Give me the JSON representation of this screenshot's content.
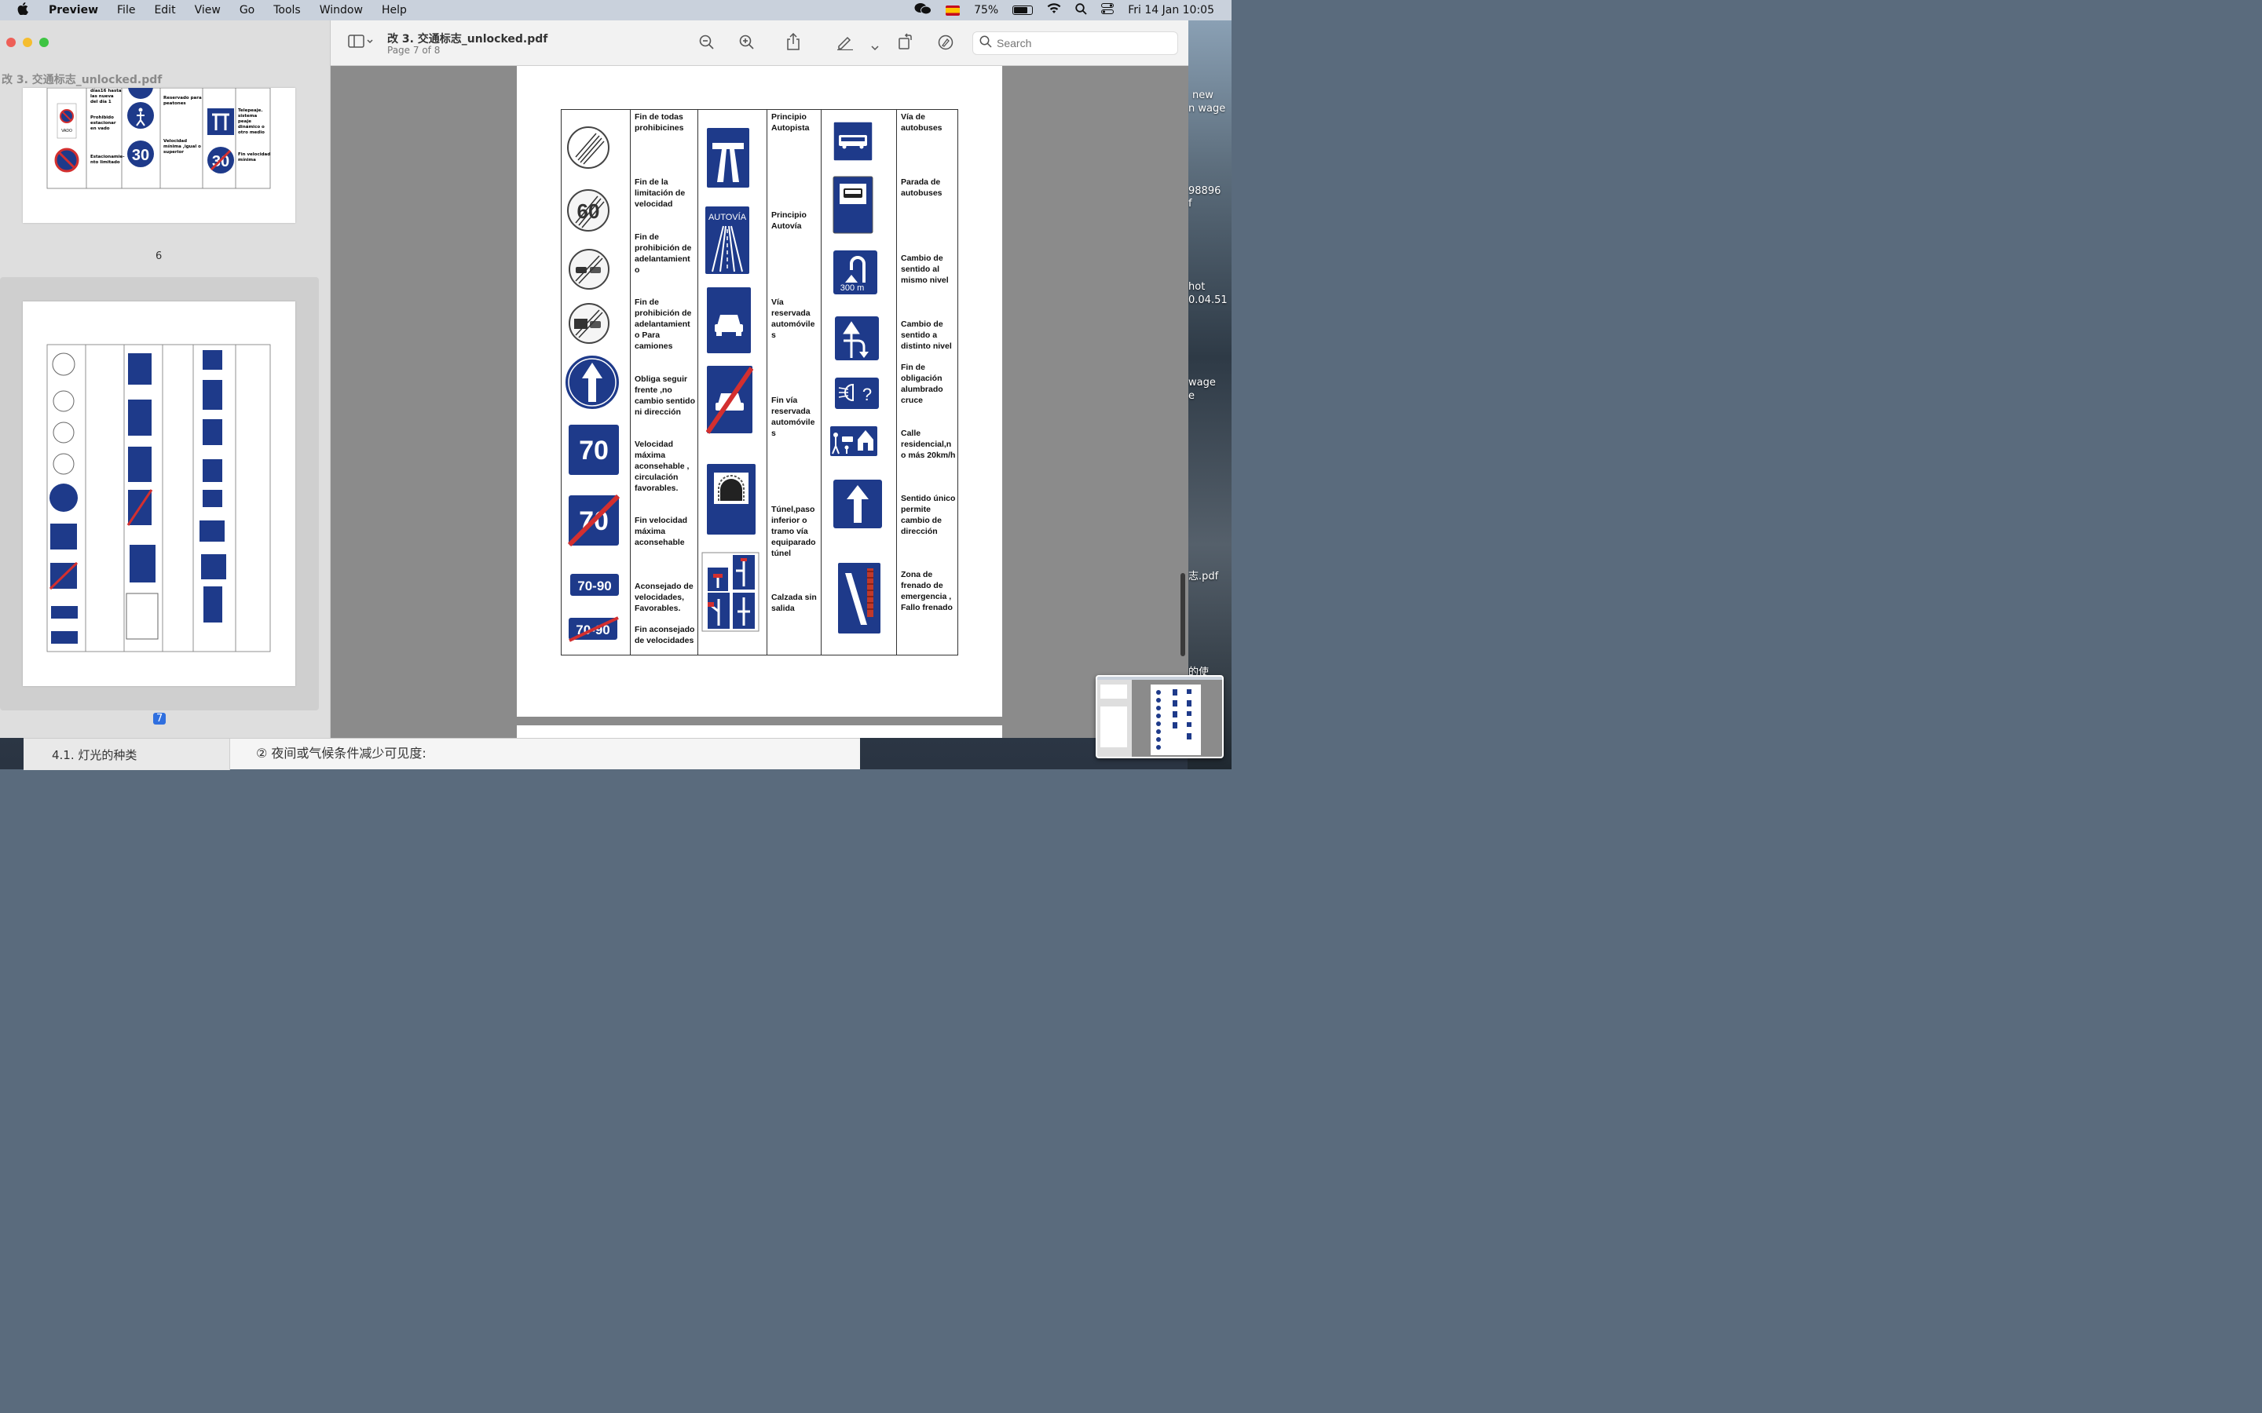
{
  "menubar": {
    "app_name": "Preview",
    "menus": [
      "File",
      "Edit",
      "View",
      "Go",
      "Tools",
      "Window",
      "Help"
    ],
    "battery": "75%",
    "battery_level": 0.75,
    "datetime": "Fri 14 Jan  10:05"
  },
  "window": {
    "sidebar_title": "改 3. 交通标志_unlocked.pdf",
    "page_numbers": [
      "6",
      "7"
    ],
    "doc_title": "改 3. 交通标志_unlocked.pdf",
    "doc_subtitle": "Page 7 of 8",
    "search_placeholder": "Search"
  },
  "desktop_labels": [
    "new",
    "n wage",
    "98896",
    "f",
    "hot",
    "0.04.51",
    "wage",
    "e",
    "志.pdf",
    "的使"
  ],
  "table": {
    "col2": [
      "Fin de todas prohibicines",
      "Fin de la limitación de velocidad",
      "Fin de prohibición de adelantamient o",
      "Fin de prohibición de adelantamient o Para camiones",
      "Obliga seguir frente ,no cambio sentido ni dirección",
      "Velocidad máxima aconsehable , circulación favorables.",
      "Fin velocidad máxima aconsehable",
      "Aconsejado de velocidades, Favorables.",
      "Fin aconsejado de velocidades"
    ],
    "col4": [
      "Principio Autopista",
      "Principio Autovía",
      "Vía reservada automóvile s",
      "Fin vía reservada automóvile s",
      "Túnel,paso inferior o tramo vía equiparado túnel",
      "Calzada sin salida"
    ],
    "col6": [
      "Vía de autobuses",
      "Parada de autobuses",
      "Cambio de sentido al mismo nivel",
      "Cambio de sentido a distinto nivel",
      "Fin de obligación alumbrado cruce",
      "Calle residencial,n o más 20km/h",
      "Sentido único permite cambio de dirección",
      "Zona de frenado de emergencia , Fallo frenado"
    ],
    "sign_texts": {
      "speed60": "60",
      "speed70": "70",
      "speed70_end": "70",
      "range": "70-90",
      "range_end": "70-90",
      "autovia": "AUTOVÍA",
      "distance": "300 m"
    }
  },
  "thumb6_labels": [
    "días16 hasta las nueva del día 1",
    "Prohibido estacionar en vado",
    "Estacionamie- nto limitado",
    "Reservado para peatones",
    "Velocidad mínima ,igual o superior",
    "Telepeaje. sistema peaje dinámico o otro medio",
    "Fin velocidad mínima"
  ],
  "thumb6_signs": {
    "speed30": "30",
    "vado": "VADO"
  },
  "bottom": {
    "left_text": "4.1. 灯光的种类",
    "right_text": "② 夜间或气候条件减少可见度:"
  },
  "colors": {
    "sign_blue": "#1e3a8a",
    "sign_red": "#d32f2f",
    "selection_blue": "#2f6fdf"
  }
}
